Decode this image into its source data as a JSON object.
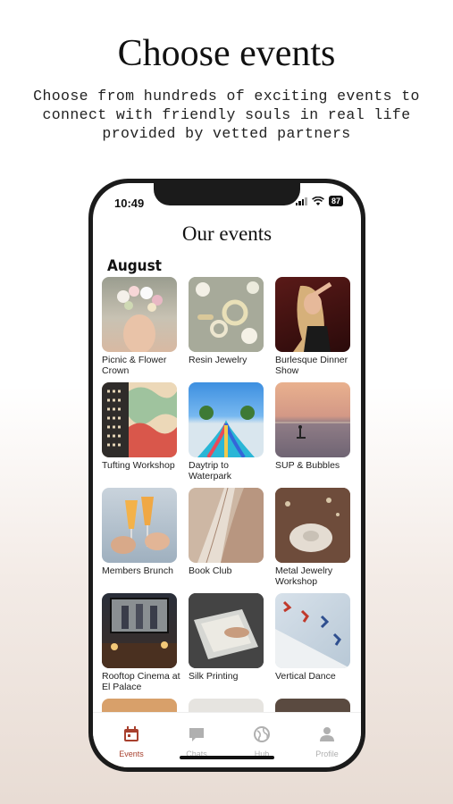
{
  "promo": {
    "title": "Choose events",
    "subtitle": "Choose from hundreds of exciting events to connect with friendly souls in real life provided by vetted partners"
  },
  "status_bar": {
    "time": "10:49",
    "battery": "87"
  },
  "app": {
    "title": "Our events",
    "month": "August",
    "events": [
      "Picnic & Flower Crown",
      "Resin Jewelry",
      "Burlesque Dinner Show",
      "Tufting Workshop",
      "Daytrip to Waterpark",
      "SUP & Bubbles",
      "Members Brunch",
      "Book Club",
      "Metal Jewelry Workshop",
      "Rooftop Cinema at El Palace",
      "Silk Printing",
      "Vertical Dance"
    ]
  },
  "tabs": [
    {
      "label": "Events",
      "icon": "calendar-icon",
      "active": true
    },
    {
      "label": "Chats",
      "icon": "chat-icon",
      "active": false
    },
    {
      "label": "Hub",
      "icon": "globe-icon",
      "active": false
    },
    {
      "label": "Profile",
      "icon": "person-icon",
      "active": false
    }
  ],
  "colors": {
    "accent": "#a8402e",
    "inactive_tab": "#b0b0b0"
  }
}
